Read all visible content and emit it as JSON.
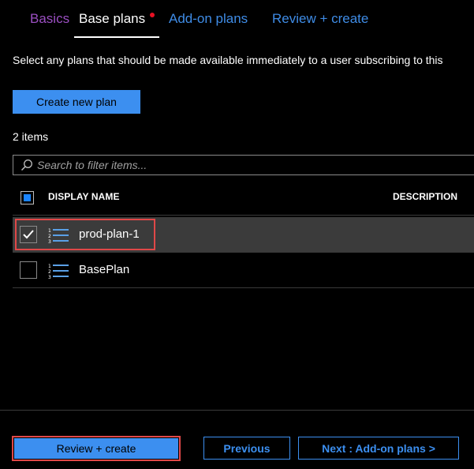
{
  "tabs": {
    "basics": "Basics",
    "base_plans": "Base plans",
    "addon_plans": "Add-on plans",
    "review_create": "Review + create"
  },
  "intro_text": "Select any plans that should be made available immediately to a user subscribing to this",
  "create_button": "Create new plan",
  "item_count": "2 items",
  "filter": {
    "placeholder": "Search to filter items...",
    "icon": "search-icon"
  },
  "table": {
    "columns": [
      "DISPLAY NAME",
      "DESCRIPTION"
    ],
    "header_checkbox_state": "partial",
    "rows": [
      {
        "name": "prod-plan-1",
        "checked": true,
        "icon": "numbered-list-icon"
      },
      {
        "name": "BasePlan",
        "checked": false,
        "icon": "numbered-list-icon"
      }
    ]
  },
  "footer": {
    "review_create": "Review + create",
    "previous": "Previous",
    "next": "Next : Add-on plans >"
  },
  "colors": {
    "accent": "#3c8ff0",
    "basics_tab": "#9b4fc2",
    "required_dot": "#e81123",
    "highlight": "#e04848",
    "selected_row": "#3b3b3b",
    "icon_blue": "#5aa0e6"
  }
}
